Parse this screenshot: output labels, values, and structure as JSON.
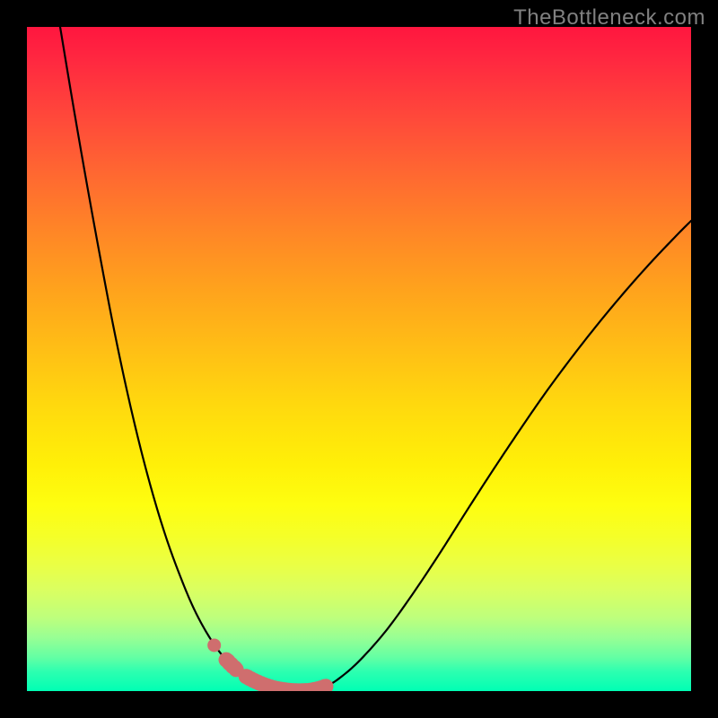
{
  "watermark": "TheBottleneck.com",
  "colors": {
    "line": "#000000",
    "marker_stroke": "#cf6e6e",
    "marker_fill": "#cf6e6e",
    "background_top": "#ff163f",
    "background_bottom": "#00ffb4",
    "frame": "#000000"
  },
  "chart_data": {
    "type": "line",
    "title": "",
    "xlabel": "",
    "ylabel": "",
    "xlim": [
      0,
      100
    ],
    "ylim": [
      0,
      100
    ],
    "grid": false,
    "legend": false,
    "series": [
      {
        "name": "bottleneck-curve",
        "x": [
          5,
          7,
          9,
          11,
          13,
          15,
          17,
          19,
          21,
          23,
          25,
          27,
          29,
          31,
          33,
          35,
          37,
          39,
          40,
          41,
          42,
          43,
          45,
          47,
          50,
          54,
          58,
          62,
          66,
          70,
          74,
          78,
          82,
          86,
          90,
          94,
          98,
          100
        ],
        "y": [
          100,
          88,
          76.5,
          65.5,
          55,
          45.5,
          37,
          29.5,
          23,
          17.5,
          12.7,
          8.9,
          5.9,
          3.7,
          2.2,
          1.2,
          0.5,
          0.15,
          0.05,
          0.02,
          0.05,
          0.15,
          0.7,
          1.9,
          4.5,
          9,
          14.5,
          20.5,
          26.8,
          33,
          39,
          44.8,
          50.2,
          55.3,
          60.1,
          64.6,
          68.8,
          70.8
        ]
      }
    ],
    "markers": {
      "name": "highlighted-points",
      "style": "thick-rounded",
      "x_ranges": [
        [
          30,
          31.5
        ],
        [
          33,
          45
        ]
      ],
      "single_points": [
        {
          "x": 28.2,
          "y": 6.9
        }
      ]
    }
  }
}
